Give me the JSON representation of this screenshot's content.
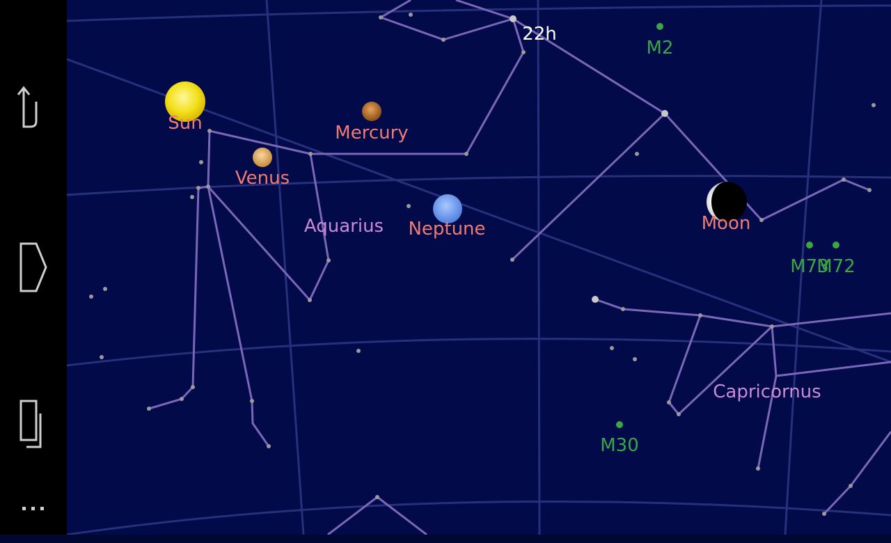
{
  "colors": {
    "background": "#020a4a",
    "grid": "#27307a",
    "constellation_line": "#7a67b8",
    "constellation_label": "#c98ad6",
    "planet_label": "#f07b73",
    "messier": "#3aa646",
    "grid_label": "#ffffff",
    "star": "#9a9a9a"
  },
  "nav": {
    "back_icon": "back-arrow-icon",
    "home_icon": "home-icon",
    "recents_icon": "recents-icon",
    "menu_icon": "overflow-menu-icon"
  },
  "grid_label": "22h",
  "planets": {
    "sun": "Sun",
    "venus": "Venus",
    "mercury": "Mercury",
    "neptune": "Neptune",
    "moon": "Moon"
  },
  "constellations": {
    "aquarius": "Aquarius",
    "capricornus": "Capricornus"
  },
  "messier": {
    "m2": "M2",
    "m73": "M73",
    "m72": "M72",
    "m30": "M30"
  }
}
